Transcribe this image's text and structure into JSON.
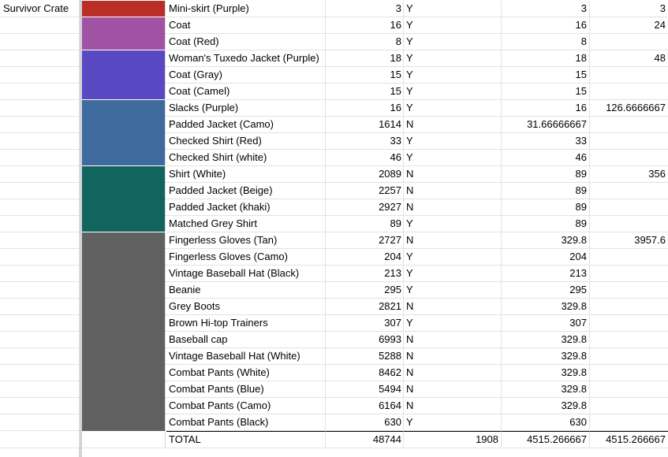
{
  "sheet": {
    "section_label": "Survivor Crate",
    "colors": {
      "red": "#b92e26",
      "pink_purple": "#a052a3",
      "violet": "#5a48c3",
      "steel_blue": "#3f6a9d",
      "teal": "#12645f",
      "gray": "#616161"
    },
    "rows": [
      {
        "name": "Mini-skirt (Purple)",
        "qty": "3",
        "flag": "Y",
        "value": "3",
        "group_total": "3",
        "color": "#b92e26"
      },
      {
        "name": "Coat",
        "qty": "16",
        "flag": "Y",
        "value": "16",
        "group_total": "24",
        "color": "#a052a3"
      },
      {
        "name": "Coat (Red)",
        "qty": "8",
        "flag": "Y",
        "value": "8",
        "group_total": "",
        "color": "#a052a3"
      },
      {
        "name": "Woman's Tuxedo Jacket (Purple)",
        "qty": "18",
        "flag": "Y",
        "value": "18",
        "group_total": "48",
        "color": "#5a48c3"
      },
      {
        "name": "Coat (Gray)",
        "qty": "15",
        "flag": "Y",
        "value": "15",
        "group_total": "",
        "color": "#5a48c3"
      },
      {
        "name": "Coat (Camel)",
        "qty": "15",
        "flag": "Y",
        "value": "15",
        "group_total": "",
        "color": "#5a48c3"
      },
      {
        "name": "Slacks (Purple)",
        "qty": "16",
        "flag": "Y",
        "value": "16",
        "group_total": "126.6666667",
        "color": "#3f6a9d"
      },
      {
        "name": "Padded Jacket (Camo)",
        "qty": "1614",
        "flag": "N",
        "value": "31.66666667",
        "group_total": "",
        "color": "#3f6a9d"
      },
      {
        "name": "Checked Shirt (Red)",
        "qty": "33",
        "flag": "Y",
        "value": "33",
        "group_total": "",
        "color": "#3f6a9d"
      },
      {
        "name": "Checked Shirt (white)",
        "qty": "46",
        "flag": "Y",
        "value": "46",
        "group_total": "",
        "color": "#3f6a9d"
      },
      {
        "name": "Shirt (White)",
        "qty": "2089",
        "flag": "N",
        "value": "89",
        "group_total": "356",
        "color": "#12645f"
      },
      {
        "name": "Padded Jacket (Beige)",
        "qty": "2257",
        "flag": "N",
        "value": "89",
        "group_total": "",
        "color": "#12645f"
      },
      {
        "name": "Padded Jacket (khaki)",
        "qty": "2927",
        "flag": "N",
        "value": "89",
        "group_total": "",
        "color": "#12645f"
      },
      {
        "name": "Matched Grey Shirt",
        "qty": "89",
        "flag": "Y",
        "value": "89",
        "group_total": "",
        "color": "#12645f"
      },
      {
        "name": "Fingerless Gloves (Tan)",
        "qty": "2727",
        "flag": "N",
        "value": "329.8",
        "group_total": "3957.6",
        "color": "#616161"
      },
      {
        "name": "Fingerless Gloves (Camo)",
        "qty": "204",
        "flag": "Y",
        "value": "204",
        "group_total": "",
        "color": "#616161"
      },
      {
        "name": "Vintage Baseball Hat (Black)",
        "qty": "213",
        "flag": "Y",
        "value": "213",
        "group_total": "",
        "color": "#616161"
      },
      {
        "name": "Beanie",
        "qty": "295",
        "flag": "Y",
        "value": "295",
        "group_total": "",
        "color": "#616161"
      },
      {
        "name": "Grey Boots",
        "qty": "2821",
        "flag": "N",
        "value": "329.8",
        "group_total": "",
        "color": "#616161"
      },
      {
        "name": "Brown Hi-top Trainers",
        "qty": "307",
        "flag": "Y",
        "value": "307",
        "group_total": "",
        "color": "#616161"
      },
      {
        "name": "Baseball cap",
        "qty": "6993",
        "flag": "N",
        "value": "329.8",
        "group_total": "",
        "color": "#616161"
      },
      {
        "name": "Vintage Baseball Hat (White)",
        "qty": "5288",
        "flag": "N",
        "value": "329.8",
        "group_total": "",
        "color": "#616161"
      },
      {
        "name": "Combat Pants (White)",
        "qty": "8462",
        "flag": "N",
        "value": "329.8",
        "group_total": "",
        "color": "#616161"
      },
      {
        "name": "Combat Pants (Blue)",
        "qty": "5494",
        "flag": "N",
        "value": "329.8",
        "group_total": "",
        "color": "#616161"
      },
      {
        "name": "Combat Pants (Camo)",
        "qty": "6164",
        "flag": "N",
        "value": "329.8",
        "group_total": "",
        "color": "#616161"
      },
      {
        "name": "Combat Pants (Black)",
        "qty": "630",
        "flag": "Y",
        "value": "630",
        "group_total": "",
        "color": "#616161"
      }
    ],
    "total": {
      "label": "TOTAL",
      "qty": "48744",
      "flag_col": "1908",
      "value": "4515.266667",
      "group_total": "4515.266667"
    }
  }
}
